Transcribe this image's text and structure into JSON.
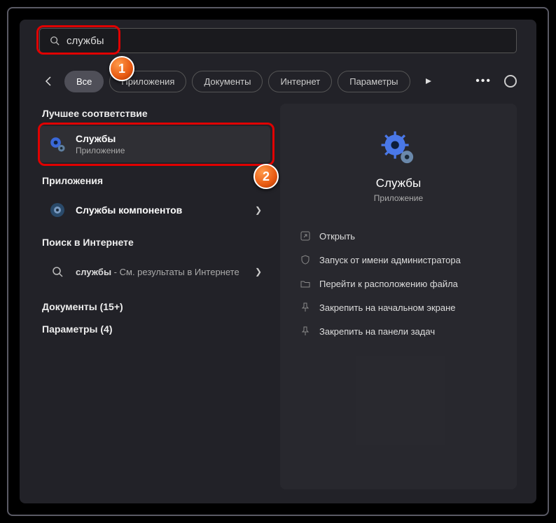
{
  "search": {
    "value": "службы"
  },
  "filters": {
    "all": "Все",
    "apps": "Приложения",
    "docs": "Документы",
    "internet": "Интернет",
    "settings": "Параметры"
  },
  "sections": {
    "best": "Лучшее соответствие",
    "apps": "Приложения",
    "web": "Поиск в Интернете",
    "docs_label": "Документы (15+)",
    "settings_label": "Параметры (4)"
  },
  "best_result": {
    "title": "Службы",
    "sub": "Приложение"
  },
  "app_result": {
    "prefix": "Службы",
    "rest": " компонентов"
  },
  "web_result": {
    "prefix": "службы",
    "rest": " - См. результаты в Интернете"
  },
  "preview": {
    "title": "Службы",
    "sub": "Приложение"
  },
  "actions": {
    "open": "Открыть",
    "admin": "Запуск от имени администратора",
    "location": "Перейти к расположению файла",
    "pin_start": "Закрепить на начальном экране",
    "pin_taskbar": "Закрепить на панели задач"
  },
  "badges": {
    "one": "1",
    "two": "2"
  }
}
